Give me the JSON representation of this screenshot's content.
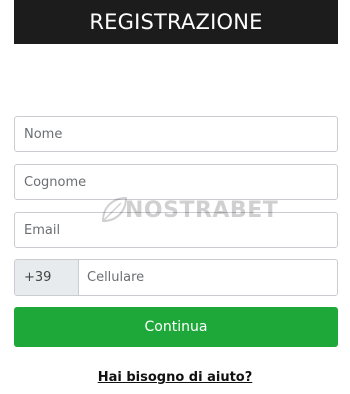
{
  "header": {
    "title": "REGISTRAZIONE"
  },
  "form": {
    "nome_placeholder": "Nome",
    "cognome_placeholder": "Cognome",
    "email_placeholder": "Email",
    "phone_prefix": "+39",
    "phone_placeholder": "Cellulare",
    "continue_label": "Continua"
  },
  "help": {
    "label": "Hai bisogno di aiuto?"
  },
  "watermark": {
    "text": "NOSTRABET"
  },
  "colors": {
    "header_bg": "#1c1c1c",
    "button_green": "#1fa83a",
    "prefix_bg": "#e8ebee"
  }
}
